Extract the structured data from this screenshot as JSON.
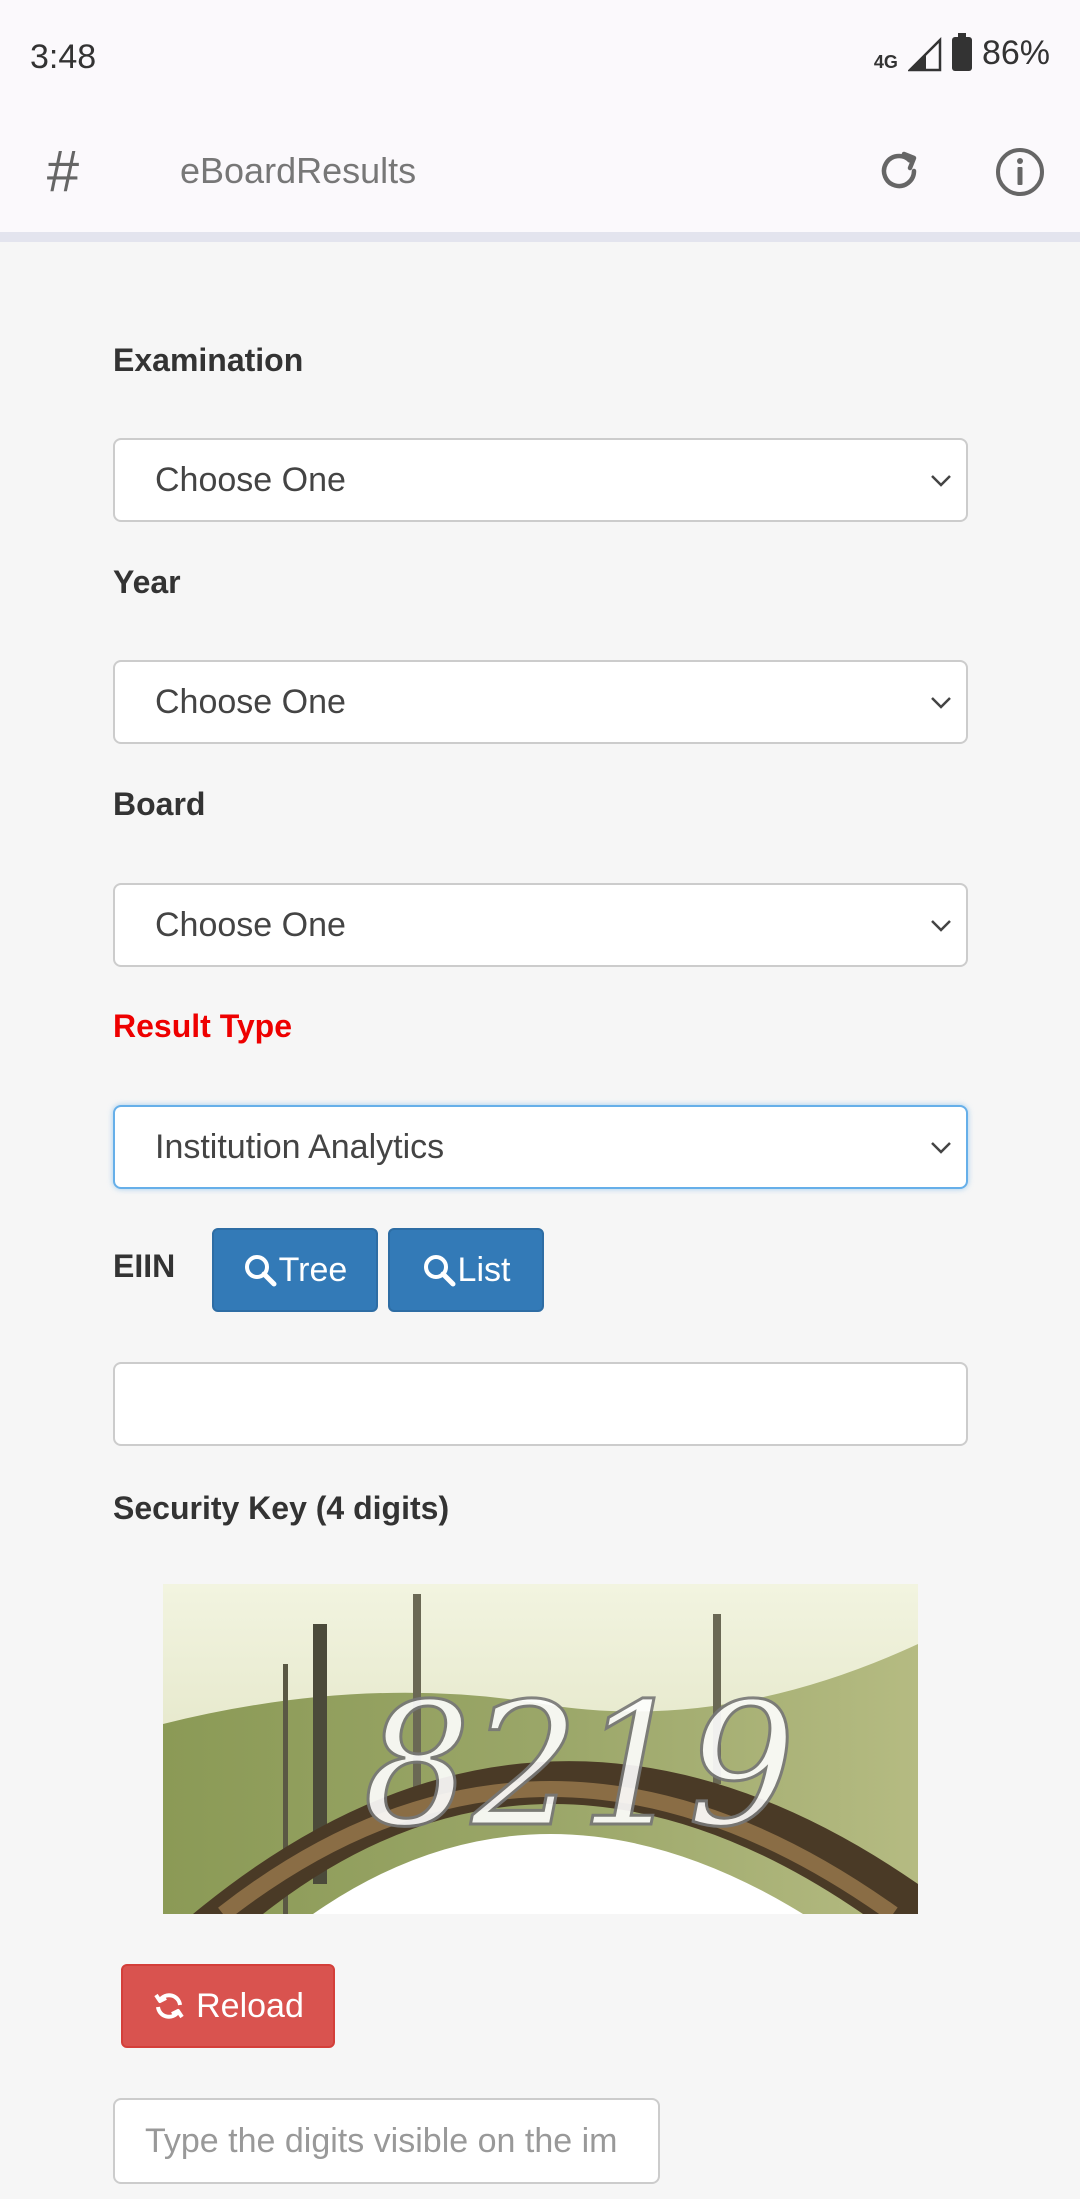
{
  "status_bar": {
    "time": "3:48",
    "network": "4G",
    "battery": "86%"
  },
  "app_bar": {
    "title": "eBoardResults",
    "left_icon": "hash-icon",
    "icons": [
      "refresh-icon",
      "info-icon"
    ]
  },
  "form": {
    "examination": {
      "label": "Examination",
      "value": "Choose One"
    },
    "year": {
      "label": "Year",
      "value": "Choose One"
    },
    "board": {
      "label": "Board",
      "value": "Choose One"
    },
    "result_type": {
      "label": "Result Type",
      "value": "Institution Analytics",
      "label_color": "#ee0000"
    },
    "eiin": {
      "label": "EIIN",
      "tree_button": "Tree",
      "list_button": "List",
      "value": ""
    },
    "security_key": {
      "label": "Security Key (4 digits)",
      "captcha_text": "8219"
    },
    "reload_button": "Reload",
    "captcha_input": {
      "placeholder": "Type the digits visible on the im"
    }
  },
  "colors": {
    "primary": "#337ab7",
    "danger": "#d9534f",
    "accent_label": "#ee0000"
  }
}
